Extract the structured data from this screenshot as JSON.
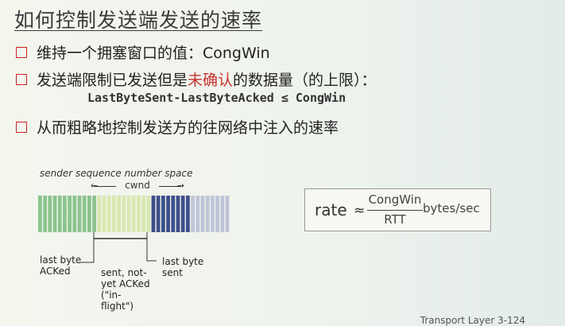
{
  "slide": {
    "title": "如何控制发送端发送的速率",
    "bullets": [
      "维持一个拥塞窗口的值：CongWin",
      "发送端限制已发送但是未确认的数据量（的上限）：",
      "从而粗略地控制发送方的往网络中注入的速率"
    ],
    "formula": {
      "left": "LastByteSent-LastByteAcked",
      "op": "≤",
      "right": "CongWin"
    },
    "bullet2_parts": {
      "before": "发送端限制已发送但是",
      "highlight": "未确认",
      "after": "的数据量（的上限）："
    }
  },
  "diagram": {
    "caption": "sender sequence number space",
    "cwnd": "cwnd",
    "label_acked": "last byte\nACKed",
    "label_inflight": "sent, not-\nyet ACKed\n(\"in-\nflight\")",
    "label_sent": "last byte\nsent",
    "colors": {
      "acked": "#8bc48e",
      "inflight": "#d8e8b0",
      "sent": "#3d4f8a",
      "free": "#bfc5d8"
    }
  },
  "rate": {
    "label": "rate",
    "approx": "≈",
    "numerator": "CongWin",
    "denominator": "RTT",
    "unit": "bytes/sec"
  },
  "footer": "Transport Layer  3-124"
}
